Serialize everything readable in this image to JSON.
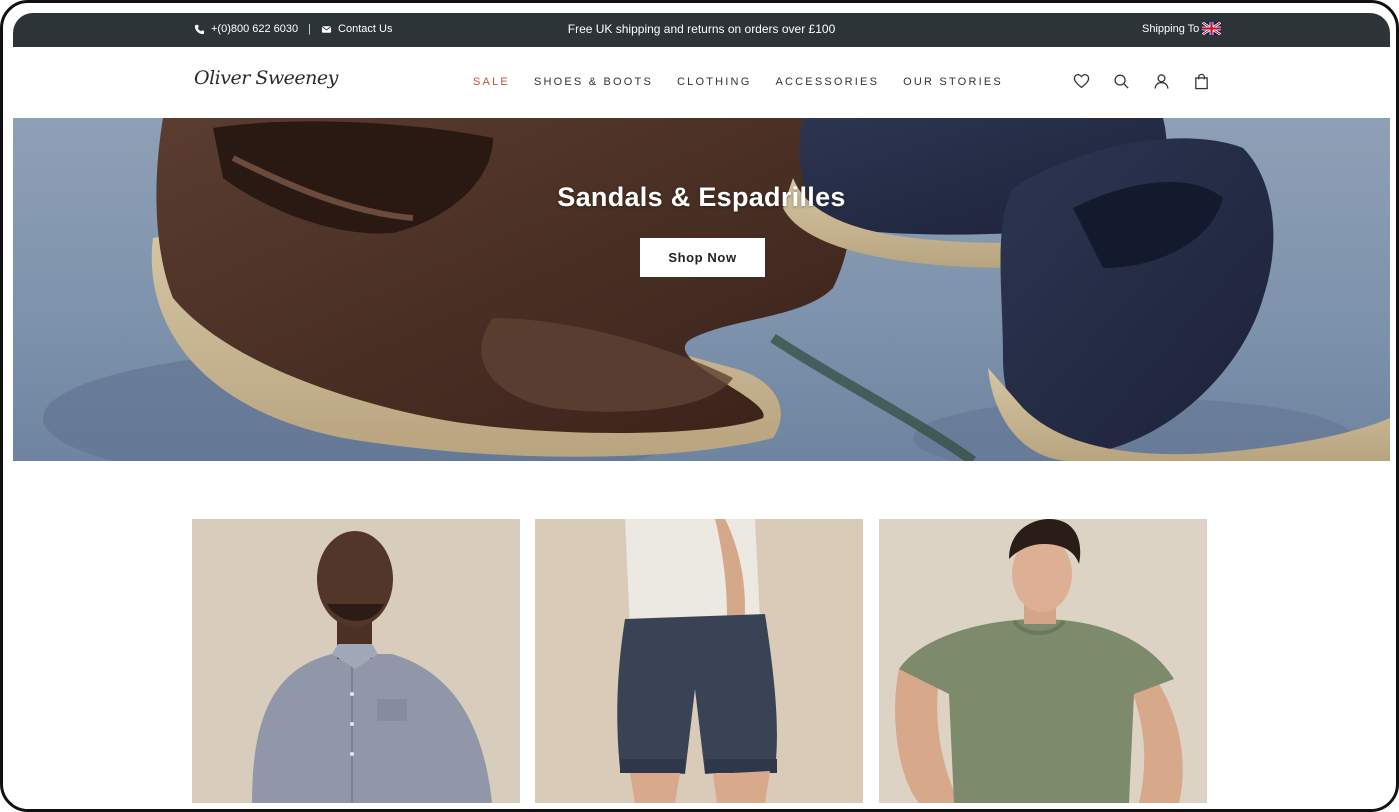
{
  "topbar": {
    "phone": "+(0)800 622 6030",
    "separator": "|",
    "contact": "Contact Us",
    "promo": "Free UK shipping and returns on orders over £100",
    "shipping_to": "Shipping To"
  },
  "header": {
    "logo": "Oliver Sweeney",
    "nav": [
      {
        "label": "SALE"
      },
      {
        "label": "SHOES & BOOTS"
      },
      {
        "label": "CLOTHING"
      },
      {
        "label": "ACCESSORIES"
      },
      {
        "label": "OUR STORIES"
      }
    ],
    "icons": [
      "heart-icon",
      "search-icon",
      "user-icon",
      "bag-icon"
    ]
  },
  "hero": {
    "title": "Sandals & Espadrilles",
    "cta": "Shop Now"
  },
  "colors": {
    "topbar_bg": "#2d3438",
    "sale_accent": "#c0533c",
    "hero_bg": "#8ea0b6"
  }
}
